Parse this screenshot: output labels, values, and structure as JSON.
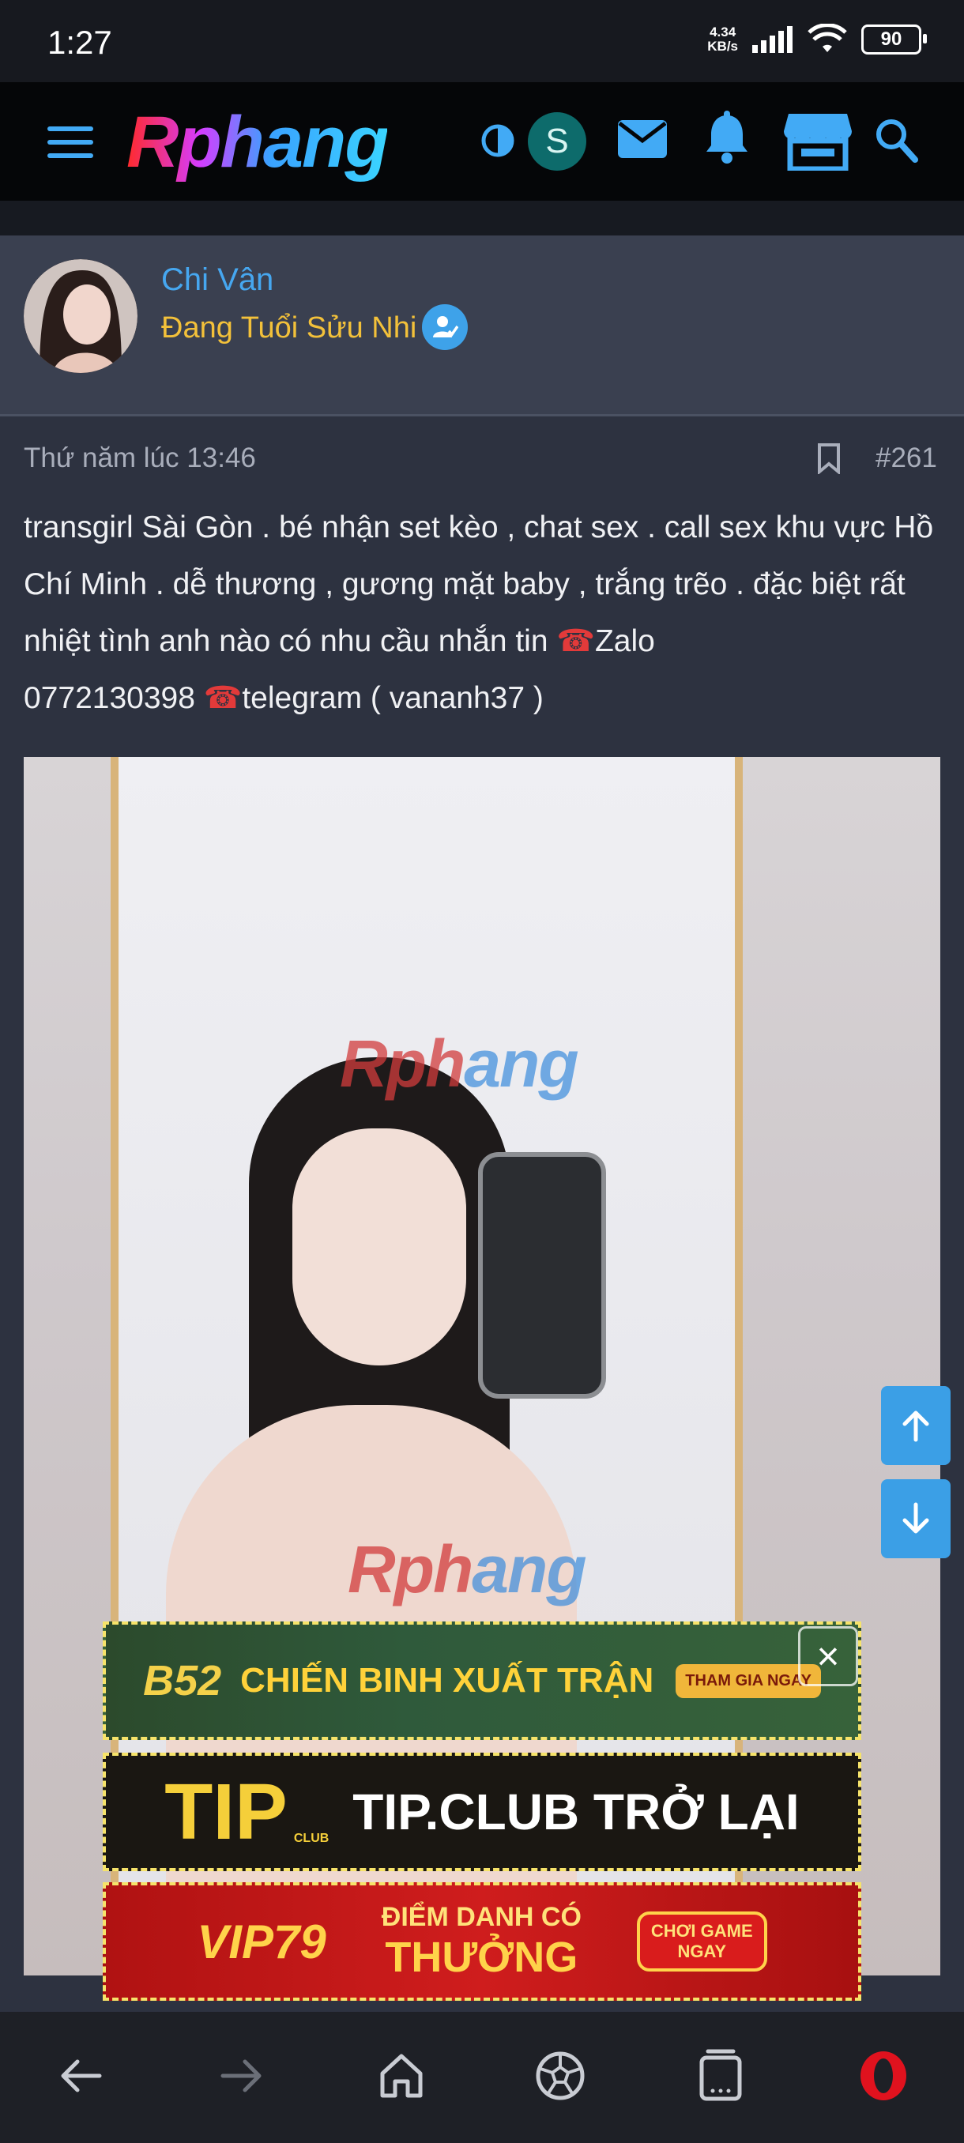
{
  "status_bar": {
    "time": "1:27",
    "network_speed_value": "4.34",
    "network_speed_unit": "KB/s",
    "battery": "90"
  },
  "nav": {
    "logo": "Rphang",
    "avatar_letter": "S"
  },
  "post": {
    "username": "Chi Vân",
    "user_title": "Đang Tuổi Sửu Nhi",
    "date": "Thứ năm lúc 13:46",
    "post_number": "#261",
    "body_part1": "transgirl Sài Gòn . bé nhận set kèo , chat sex . call sex khu vực Hồ Chí Minh . dễ thương , gương mặt baby , trắng trẽo . đặc biệt rất nhiệt tình anh nào có nhu cầu nhắn tin ",
    "body_part2": "Zalo\n0772130398 ",
    "body_part3": "telegram ( vananh37 )",
    "phone_glyph": "☎"
  },
  "image_watermark": {
    "red": "Rph",
    "blue": "ang"
  },
  "ads": {
    "ad1_brand": "B52",
    "ad1_text": "CHIẾN BINH XUẤT TRẬN",
    "ad1_cta": "THAM GIA NGAY",
    "ad2_brand": "TIP",
    "ad2_sub": "CLUB",
    "ad2_text": "TIP.CLUB TRỞ LẠI",
    "ad3_brand": "VIP79",
    "ad3_text_top": "ĐIỂM DANH CÓ",
    "ad3_text_bottom": "THƯỞNG",
    "ad3_cta_top": "CHƠI GAME",
    "ad3_cta_bottom": "NGAY"
  },
  "colors": {
    "accent": "#3ea2e9",
    "title_gold": "#f3c13a",
    "username_blue": "#46a7f0",
    "opera_red": "#e0121e"
  }
}
